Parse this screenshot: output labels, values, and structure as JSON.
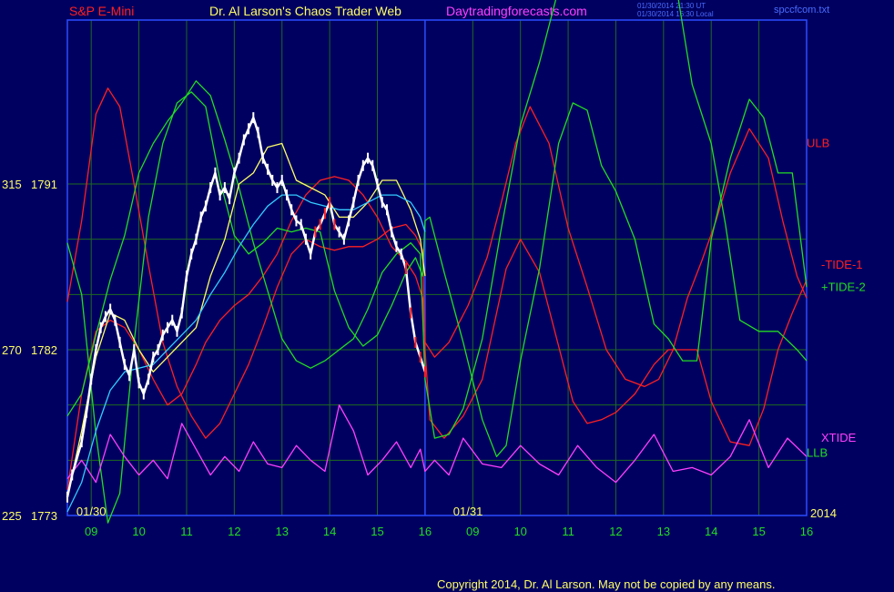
{
  "header": {
    "instrument": "S&P E-Mini",
    "title": "Dr. Al Larson's Chaos Trader Web",
    "website": "Daytradingforecasts.com",
    "timestamp1": "01/30/2014 21:30 UT",
    "timestamp2": "01/30/2014 16:30 Local",
    "filename": "spccfcom.txt"
  },
  "footer": {
    "copyright": "Copyright 2014, Dr. Al Larson. May not be copied by any means."
  },
  "colors": {
    "background": "#000060",
    "grid": "#1e6a1e",
    "frame": "#2a4cff",
    "price": "#ffffff",
    "red": "#ff2020",
    "green": "#22dd22",
    "magenta": "#ff40ff",
    "cyan": "#33ccff",
    "yellow": "#ffff66"
  },
  "chart_data": {
    "type": "line",
    "title": "S&P E-Mini",
    "x_tick_labels": [
      "09",
      "10",
      "11",
      "12",
      "13",
      "14",
      "15",
      "16",
      "09",
      "10",
      "11",
      "12",
      "13",
      "14",
      "15",
      "16"
    ],
    "x_range": [
      8.5,
      24
    ],
    "day_separator_x": 16,
    "date_labels": [
      {
        "x": 9,
        "text": "01/30"
      },
      {
        "x": 16.9,
        "text": "01/31"
      }
    ],
    "year_label": "2014",
    "y_range": [
      225,
      315
    ],
    "y_tick_labels": [
      {
        "y": 315,
        "left": "315",
        "right": "1791"
      },
      {
        "y": 270,
        "left": "270",
        "right": "1782"
      },
      {
        "y": 225,
        "left": "225",
        "right": "1773"
      }
    ],
    "y_grid": [
      300,
      285,
      255,
      240
    ],
    "series": [
      {
        "name": "ULB",
        "label_y": 325,
        "color": "red",
        "x": [
          8.5,
          8.8,
          9.1,
          9.35,
          9.6,
          9.9,
          10.2,
          10.5,
          10.8,
          11.1,
          11.4,
          11.7,
          12.0,
          12.3,
          12.6,
          12.9,
          13.2,
          13.5,
          13.8,
          14.1,
          14.4,
          14.7,
          15.0,
          15.3,
          15.6,
          15.8,
          15.95,
          16.0,
          16.1,
          16.4,
          16.8,
          17.2,
          17.5,
          17.7,
          18.0,
          18.4,
          18.8,
          19.1,
          19.4,
          19.7,
          20.0,
          20.4,
          20.8,
          21.1,
          21.4,
          21.7,
          22.0,
          22.4,
          22.8,
          23.1,
          23.4,
          23.7,
          24.0
        ],
        "y": [
          283,
          305,
          334,
          341,
          336,
          315,
          293,
          272,
          260,
          252,
          246,
          250,
          258,
          266,
          276,
          287,
          296,
          300,
          298,
          297,
          298,
          298,
          300,
          303,
          304,
          301,
          297,
          270,
          251,
          246,
          252,
          262,
          280,
          292,
          300,
          291,
          271,
          256,
          250,
          251,
          253,
          258,
          266,
          270,
          270,
          270,
          256,
          245,
          244,
          254,
          270,
          280,
          289
        ]
      },
      {
        "name": "-TIDE-1",
        "label_y": 292,
        "color": "red",
        "x": [
          8.5,
          8.8,
          9.1,
          9.4,
          9.7,
          10.0,
          10.3,
          10.6,
          10.9,
          11.2,
          11.4,
          11.7,
          12.0,
          12.3,
          12.6,
          12.9,
          13.2,
          13.5,
          13.8,
          14.1,
          14.4,
          14.7,
          15.0,
          15.3,
          15.6,
          15.8,
          15.95,
          16.0,
          16.2,
          16.5,
          16.9,
          17.3,
          17.6,
          17.9,
          18.2,
          18.6,
          19.0,
          19.4,
          19.8,
          20.2,
          20.6,
          20.9,
          21.2,
          21.5,
          21.8,
          22.1,
          22.4,
          22.8,
          23.2,
          23.5,
          23.8,
          24.0
        ],
        "y": [
          232,
          258,
          275,
          278,
          276,
          270,
          262,
          255,
          258,
          266,
          272,
          278,
          282,
          285,
          290,
          296,
          305,
          312,
          316,
          317,
          316,
          312,
          306,
          298,
          294,
          290,
          284,
          272,
          268,
          272,
          282,
          295,
          310,
          326,
          336,
          326,
          303,
          287,
          270,
          262,
          260,
          262,
          270,
          284,
          294,
          305,
          318,
          330,
          322,
          305,
          290,
          284
        ]
      },
      {
        "name": "+TIDE-2",
        "label_y": 286,
        "color": "green",
        "x": [
          8.5,
          8.8,
          9.1,
          9.4,
          9.7,
          10.0,
          10.3,
          10.6,
          10.9,
          11.2,
          11.5,
          11.8,
          12.1,
          12.4,
          12.7,
          13.0,
          13.3,
          13.6,
          13.9,
          14.2,
          14.5,
          14.8,
          15.1,
          15.4,
          15.7,
          15.9,
          16.0,
          16.2,
          16.5,
          16.8,
          17.2,
          17.6,
          18.0,
          18.4,
          18.8,
          19.2,
          19.6,
          20.0,
          20.4,
          20.7,
          21.0,
          21.3,
          21.6,
          22.0,
          22.3,
          22.6,
          23.0,
          23.4,
          23.8,
          24.0
        ],
        "y": [
          252,
          258,
          274,
          289,
          301,
          318,
          326,
          332,
          337,
          343,
          339,
          327,
          314,
          299,
          286,
          273,
          267,
          265,
          267,
          270,
          273,
          281,
          291,
          296,
          299,
          296,
          262,
          246,
          247,
          254,
          273,
          303,
          331,
          348,
          368,
          388,
          403,
          411,
          411,
          405,
          387,
          366,
          342,
          326,
          304,
          278,
          275,
          275,
          270,
          267
        ]
      },
      {
        "name": "LLB",
        "label_y": 241,
        "color": "green",
        "x": [
          8.5,
          8.8,
          9.1,
          9.35,
          9.6,
          9.9,
          10.2,
          10.5,
          10.8,
          11.1,
          11.4,
          11.7,
          12.0,
          12.3,
          12.6,
          12.9,
          13.2,
          13.5,
          13.8,
          14.1,
          14.4,
          14.7,
          15.0,
          15.3,
          15.6,
          15.8,
          15.95,
          16.0,
          16.1,
          16.4,
          16.8,
          17.2,
          17.5,
          17.7,
          18.0,
          18.4,
          18.8,
          19.1,
          19.4,
          19.7,
          20.0,
          20.4,
          20.8,
          21.1,
          21.4,
          21.7,
          22.0,
          22.4,
          22.8,
          23.1,
          23.4,
          23.7,
          24.0
        ],
        "y": [
          299,
          285,
          247,
          223,
          231,
          272,
          306,
          326,
          337,
          340,
          336,
          316,
          301,
          296,
          299,
          303,
          302,
          303,
          302,
          286,
          276,
          271,
          274,
          282,
          291,
          295,
          290,
          305,
          306,
          291,
          272,
          251,
          241,
          244,
          267,
          292,
          326,
          337,
          335,
          320,
          313,
          300,
          277,
          273,
          267,
          267,
          300,
          322,
          338,
          333,
          318,
          318,
          287
        ]
      },
      {
        "name": "XTIDE",
        "label_y": 245,
        "color": "magenta",
        "x": [
          8.5,
          8.8,
          9.1,
          9.4,
          9.7,
          10.0,
          10.3,
          10.6,
          10.9,
          11.2,
          11.5,
          11.8,
          12.1,
          12.4,
          12.7,
          13.0,
          13.3,
          13.6,
          13.9,
          14.2,
          14.5,
          14.8,
          15.1,
          15.4,
          15.7,
          15.9,
          16.0,
          16.2,
          16.5,
          16.8,
          17.2,
          17.6,
          18.0,
          18.4,
          18.8,
          19.2,
          19.6,
          20.0,
          20.4,
          20.8,
          21.2,
          21.6,
          22.0,
          22.4,
          22.8,
          23.2,
          23.6,
          24.0
        ],
        "y": [
          235,
          240,
          234,
          247,
          241,
          236,
          240,
          235,
          250,
          243,
          236,
          241,
          237,
          245,
          239,
          238,
          244,
          240,
          237,
          255,
          248,
          236,
          240,
          245,
          238,
          243,
          237,
          240,
          236,
          246,
          239,
          238,
          244,
          239,
          236,
          244,
          238,
          234,
          240,
          247,
          237,
          238,
          236,
          241,
          251,
          238,
          246,
          241
        ]
      },
      {
        "name": "Fast MA",
        "color": "yellow",
        "x": [
          8.5,
          8.8,
          9.1,
          9.4,
          9.7,
          10.0,
          10.3,
          10.6,
          10.9,
          11.2,
          11.5,
          11.8,
          12.1,
          12.4,
          12.7,
          13.0,
          13.3,
          13.6,
          13.9,
          14.2,
          14.5,
          14.8,
          15.1,
          15.4,
          15.7,
          15.9,
          16.0
        ],
        "y": [
          230,
          248,
          268,
          280,
          278,
          270,
          264,
          268,
          272,
          276,
          290,
          300,
          315,
          318,
          325,
          326,
          316,
          314,
          312,
          306,
          306,
          310,
          316,
          316,
          308,
          300,
          290
        ]
      },
      {
        "name": "Slow MA",
        "color": "cyan",
        "x": [
          8.5,
          8.8,
          9.1,
          9.4,
          9.7,
          10.0,
          10.3,
          10.6,
          10.9,
          11.2,
          11.5,
          11.8,
          12.1,
          12.4,
          12.7,
          13.0,
          13.3,
          13.6,
          13.9,
          14.2,
          14.5,
          14.8,
          15.1,
          15.4,
          15.7,
          15.9,
          16.0
        ],
        "y": [
          226,
          234,
          248,
          259,
          264,
          265,
          266,
          270,
          274,
          278,
          285,
          291,
          298,
          304,
          309,
          312,
          312,
          310,
          309,
          308,
          308,
          310,
          312,
          312,
          310,
          306,
          302
        ]
      },
      {
        "name": "Price",
        "color": "price",
        "x": [
          8.5,
          8.6,
          8.8,
          8.9,
          9.0,
          9.1,
          9.2,
          9.3,
          9.4,
          9.5,
          9.6,
          9.7,
          9.8,
          9.9,
          10.0,
          10.1,
          10.2,
          10.3,
          10.4,
          10.5,
          10.6,
          10.7,
          10.8,
          10.9,
          11.0,
          11.1,
          11.2,
          11.3,
          11.4,
          11.5,
          11.6,
          11.7,
          11.8,
          11.9,
          12.0,
          12.1,
          12.2,
          12.3,
          12.4,
          12.5,
          12.6,
          12.7,
          12.8,
          12.9,
          13.0,
          13.1,
          13.2,
          13.3,
          13.4,
          13.5,
          13.6,
          13.7,
          13.8,
          13.9,
          14.0,
          14.1,
          14.2,
          14.3,
          14.4,
          14.5,
          14.6,
          14.7,
          14.8,
          14.9,
          15.0,
          15.1,
          15.2,
          15.3,
          15.4,
          15.5,
          15.6,
          15.7,
          15.8,
          15.9,
          16.0
        ],
        "y": [
          230,
          236,
          245,
          253,
          262,
          270,
          276,
          279,
          281,
          278,
          272,
          266,
          263,
          270,
          261,
          258,
          262,
          268,
          270,
          274,
          276,
          278,
          275,
          280,
          290,
          296,
          300,
          306,
          309,
          314,
          318,
          312,
          314,
          311,
          318,
          322,
          327,
          330,
          333,
          329,
          322,
          319,
          316,
          314,
          316,
          312,
          308,
          305,
          304,
          300,
          296,
          302,
          304,
          307,
          310,
          304,
          302,
          300,
          305,
          310,
          316,
          320,
          322,
          320,
          315,
          310,
          308,
          302,
          298,
          296,
          292,
          280,
          272,
          268,
          264
        ]
      }
    ]
  }
}
